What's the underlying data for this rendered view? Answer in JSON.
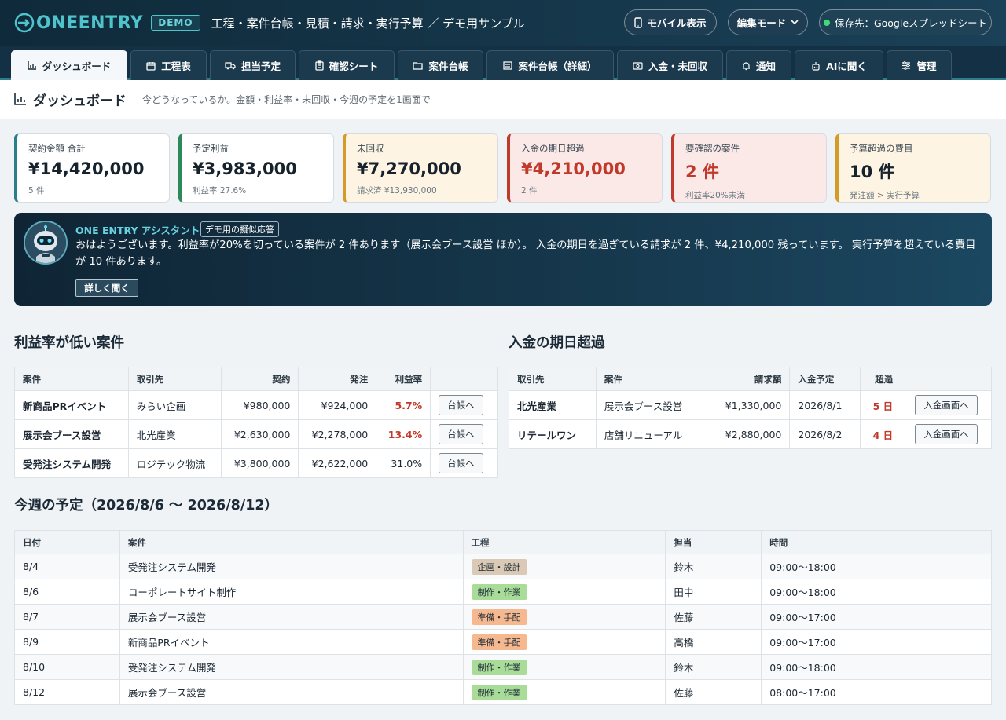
{
  "header": {
    "logo_text": "ONEENTRY",
    "demo_badge": "DEMO",
    "app_title": "工程・案件台帳・見積・請求・実行予算 ／ デモ用サンプル",
    "mobile_button": "モバイル表示",
    "mode_select": "編集モード",
    "save_target": "保存先：Googleスプレッドシート",
    "status_color": "#3ddc74"
  },
  "tabs": [
    {
      "label": "ダッシュボード",
      "icon": "bar-chart-icon",
      "active": true
    },
    {
      "label": "工程表",
      "icon": "calendar-icon"
    },
    {
      "label": "担当予定",
      "icon": "truck-icon"
    },
    {
      "label": "確認シート",
      "icon": "clipboard-icon"
    },
    {
      "label": "案件台帳",
      "icon": "folder-icon"
    },
    {
      "label": "案件台帳（詳細）",
      "icon": "list-icon"
    },
    {
      "label": "入金・未回収",
      "icon": "money-icon"
    },
    {
      "label": "通知",
      "icon": "bell-icon"
    },
    {
      "label": "AIに聞く",
      "icon": "robot-icon"
    },
    {
      "label": "管理",
      "icon": "sliders-icon"
    }
  ],
  "page": {
    "title": "ダッシュボード",
    "subtitle": "今どうなっているか。金額・利益率・未回収・今週の予定を1画面で"
  },
  "cards": [
    {
      "label": "契約金額 合計",
      "value": "¥14,420,000",
      "note": "5 件"
    },
    {
      "label": "予定利益",
      "value": "¥3,983,000",
      "note": "利益率 27.6%"
    },
    {
      "label": "未回収",
      "value": "¥7,270,000",
      "note": "請求済 ¥13,930,000"
    },
    {
      "label": "入金の期日超過",
      "value": "¥4,210,000",
      "note": "2 件"
    },
    {
      "label": "要確認の案件",
      "value": "2 件",
      "note": "利益率20%未満"
    },
    {
      "label": "予算超過の費目",
      "value": "10 件",
      "note": "発注額 > 実行予算"
    }
  ],
  "assistant": {
    "name": "ONE ENTRY アシスタント",
    "tag": "デモ用の擬似応答",
    "message": "おはようございます。利益率が20%を切っている案件が 2 件あります（展示会ブース設営 ほか）。 入金の期日を過ぎている請求が 2 件、¥4,210,000 残っています。 実行予算を超えている費目が 10 件あります。",
    "more_button": "詳しく聞く"
  },
  "low_margin": {
    "title": "利益率が低い案件",
    "headers": [
      "案件",
      "取引先",
      "契約",
      "発注",
      "利益率",
      ""
    ],
    "rows": [
      {
        "project": "新商品PRイベント",
        "client": "みらい企画",
        "contract": "¥980,000",
        "order": "¥924,000",
        "margin": "5.7%",
        "button": "台帳へ"
      },
      {
        "project": "展示会ブース設営",
        "client": "北光産業",
        "contract": "¥2,630,000",
        "order": "¥2,278,000",
        "margin": "13.4%",
        "button": "台帳へ"
      },
      {
        "project": "受発注システム開発",
        "client": "ロジテック物流",
        "contract": "¥3,800,000",
        "order": "¥2,622,000",
        "margin": "31.0%",
        "button": "台帳へ"
      }
    ]
  },
  "overdue": {
    "title": "入金の期日超過",
    "headers": [
      "取引先",
      "案件",
      "請求額",
      "入金予定",
      "超過",
      ""
    ],
    "rows": [
      {
        "client": "北光産業",
        "project": "展示会ブース設営",
        "amount": "¥1,330,000",
        "due": "2026/8/1",
        "over": "5 日",
        "button": "入金画面へ"
      },
      {
        "client": "リテールワン",
        "project": "店舗リニューアル",
        "amount": "¥2,880,000",
        "due": "2026/8/2",
        "over": "4 日",
        "button": "入金画面へ"
      }
    ]
  },
  "week": {
    "title": "今週の予定（2026/8/6 〜 2026/8/12）",
    "headers": [
      "日付",
      "案件",
      "工程",
      "担当",
      "時間"
    ],
    "rows": [
      {
        "date": "8/4",
        "project": "受発注システム開発",
        "phase": "企画・設計",
        "color": "#d9c9b5",
        "owner": "鈴木",
        "time": "09:00〜18:00"
      },
      {
        "date": "8/6",
        "project": "コーポレートサイト制作",
        "phase": "制作・作業",
        "color": "#a9dc98",
        "owner": "田中",
        "time": "09:00〜18:00"
      },
      {
        "date": "8/7",
        "project": "展示会ブース設営",
        "phase": "準備・手配",
        "color": "#f6b88e",
        "owner": "佐藤",
        "time": "09:00〜17:00"
      },
      {
        "date": "8/9",
        "project": "新商品PRイベント",
        "phase": "準備・手配",
        "color": "#f6b88e",
        "owner": "高橋",
        "time": "09:00〜17:00"
      },
      {
        "date": "8/10",
        "project": "受発注システム開発",
        "phase": "制作・作業",
        "color": "#a9dc98",
        "owner": "鈴木",
        "time": "09:00〜18:00"
      },
      {
        "date": "8/12",
        "project": "展示会ブース設営",
        "phase": "制作・作業",
        "color": "#a9dc98",
        "owner": "佐藤",
        "time": "08:00〜17:00"
      }
    ]
  }
}
